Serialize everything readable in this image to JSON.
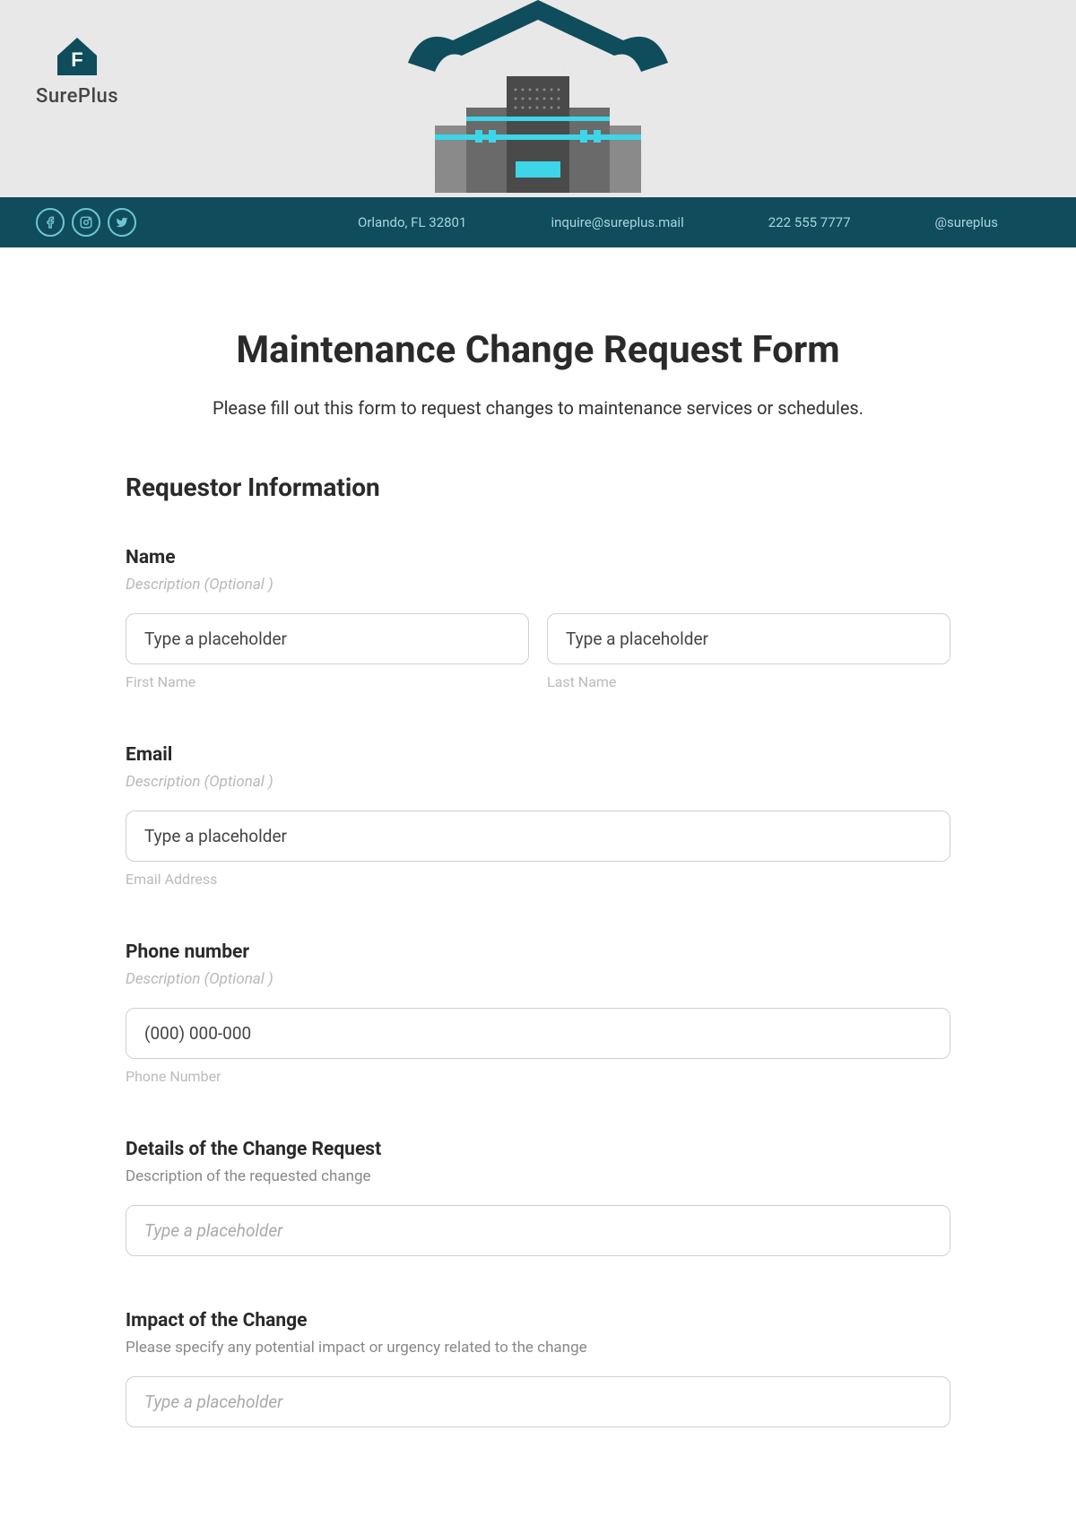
{
  "brand": {
    "name": "SurePlus"
  },
  "contact": {
    "address": "Orlando, FL 32801",
    "email": "inquire@sureplus.mail",
    "phone": "222 555 7777",
    "handle": "@sureplus"
  },
  "form": {
    "title": "Maintenance Change Request Form",
    "subtitle": "Please fill out this form to request changes to maintenance services or schedules.",
    "section_requestor": "Requestor Information",
    "name": {
      "label": "Name",
      "desc": "Description  (Optional )",
      "first_placeholder": "Type a placeholder",
      "first_sublabel": "First Name",
      "last_placeholder": "Type a placeholder",
      "last_sublabel": "Last Name"
    },
    "email": {
      "label": "Email",
      "desc": "Description  (Optional )",
      "placeholder": "Type a placeholder",
      "sublabel": "Email Address"
    },
    "phone": {
      "label": "Phone number",
      "desc": "Description  (Optional )",
      "placeholder": "(000) 000-000",
      "sublabel": "Phone Number"
    },
    "details": {
      "label": "Details of the Change Request",
      "hint": "Description of the requested change",
      "placeholder": "Type a placeholder"
    },
    "impact": {
      "label": "Impact of the Change",
      "hint": "Please specify any potential impact or urgency related to the change",
      "placeholder": "Type a placeholder"
    }
  }
}
